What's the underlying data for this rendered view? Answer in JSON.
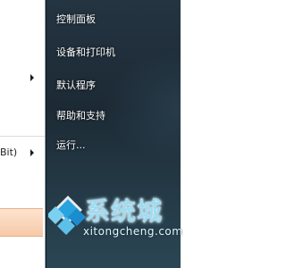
{
  "start_menu": {
    "right_items": [
      {
        "label": "控制面板"
      },
      {
        "label": "设备和打印机"
      },
      {
        "label": "默认程序"
      },
      {
        "label": "帮助和支持"
      },
      {
        "label": "运行..."
      }
    ],
    "left_partial_item": {
      "label": "Bit)"
    }
  },
  "watermark": {
    "logo_text": "系统城",
    "url": "xitongcheng.com",
    "icon": "diamond-logo-icon"
  },
  "colors": {
    "right_pane": "#1c2a35",
    "search_strip": "#f7c9a8",
    "logo_blue": "#2aa6e0"
  }
}
